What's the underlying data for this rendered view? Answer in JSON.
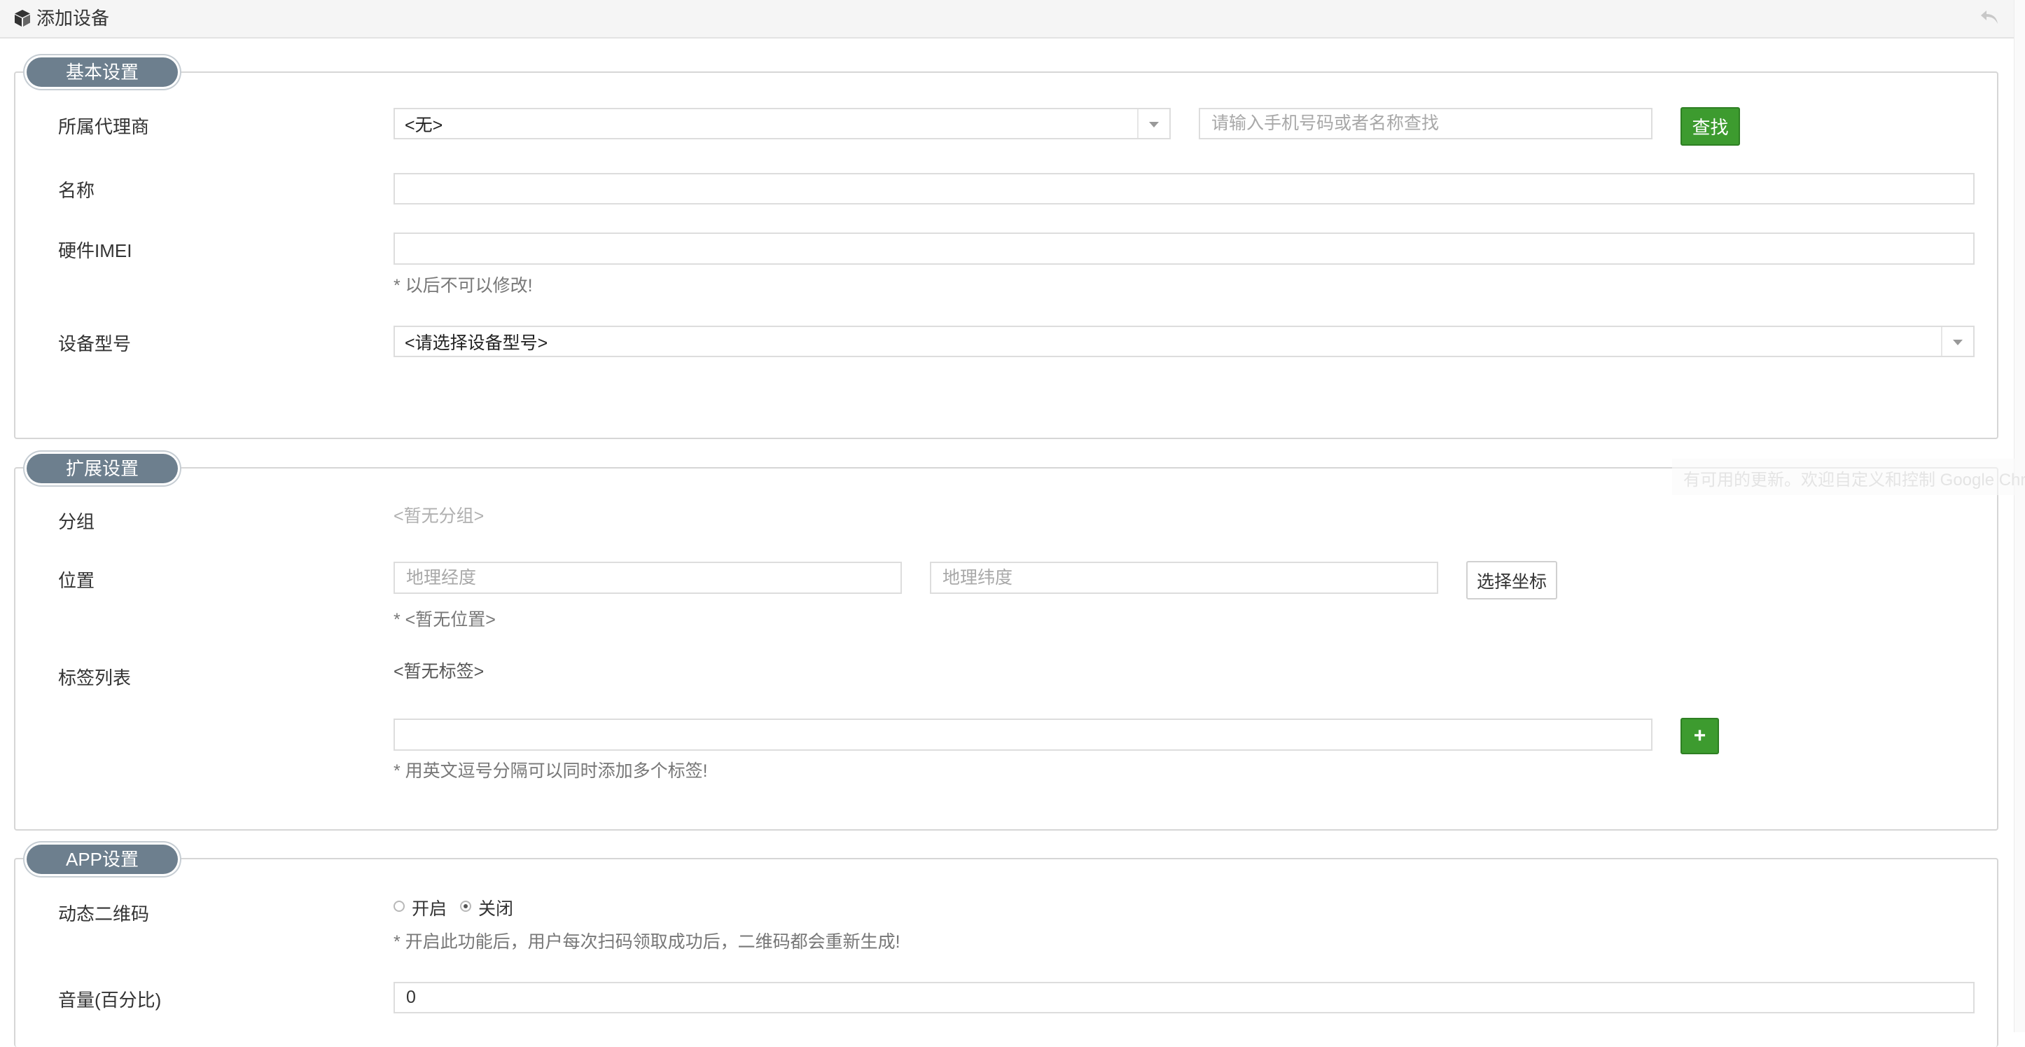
{
  "header": {
    "title": "添加设备",
    "icon": "cube-icon",
    "back_icon": "undo-icon"
  },
  "sections": {
    "basic": {
      "title": "基本设置"
    },
    "extended": {
      "title": "扩展设置"
    },
    "app": {
      "title": "APP设置"
    }
  },
  "basic": {
    "agent": {
      "label": "所属代理商",
      "selected": "<无>",
      "search_placeholder": "请输入手机号码或者名称查找",
      "search_button": "查找"
    },
    "name": {
      "label": "名称",
      "value": ""
    },
    "imei": {
      "label": "硬件IMEI",
      "value": "",
      "hint": "* 以后不可以修改!"
    },
    "model": {
      "label": "设备型号",
      "selected": "<请选择设备型号>"
    }
  },
  "extended": {
    "group": {
      "label": "分组",
      "value": "<暂无分组>"
    },
    "location": {
      "label": "位置",
      "lng_placeholder": "地理经度",
      "lat_placeholder": "地理纬度",
      "pick_button": "选择坐标",
      "hint": "* <暂无位置>"
    },
    "tags": {
      "label": "标签列表",
      "current": "<暂无标签>",
      "input_value": "",
      "add_button": "+",
      "hint": "* 用英文逗号分隔可以同时添加多个标签!"
    }
  },
  "app": {
    "dynamic_qr": {
      "label": "动态二维码",
      "options": [
        "开启",
        "关闭"
      ],
      "selected": "关闭",
      "hint": "* 开启此功能后，用户每次扫码领取成功后，二维码都会重新生成!"
    },
    "volume": {
      "label": "音量(百分比)",
      "value": "0"
    }
  },
  "notification": {
    "text": "有可用的更新。欢迎自定义和控制 Google Chrom"
  },
  "colors": {
    "accent_green": "#3d9b2f",
    "legend_bg": "#6d7f8e",
    "hint_gray": "#777777"
  }
}
